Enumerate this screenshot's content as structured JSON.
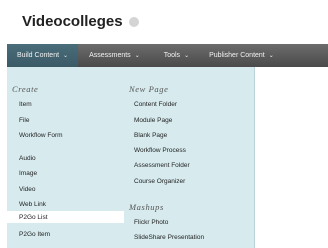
{
  "course": {
    "title": "Videocolleges"
  },
  "toolbar": {
    "build_content": "Build Content",
    "assessments": "Assessments",
    "tools": "Tools",
    "publisher_content": "Publisher Content",
    "chevron": "⌄"
  },
  "menu": {
    "create_heading": "Create",
    "create_items": [
      "Item",
      "File",
      "Workflow Form",
      "Audio",
      "Image",
      "Video",
      "Web Link",
      "P2Go List",
      "P2Go Item"
    ],
    "new_page_heading": "New Page",
    "new_page_items": [
      "Content Folder",
      "Module Page",
      "Blank Page",
      "Workflow Process",
      "Assessment Folder",
      "Course Organizer"
    ],
    "mashups_heading": "Mashups",
    "mashups_items": [
      "Flickr Photo",
      "SlideShare Presentation"
    ],
    "hovered_item": "P2Go List"
  }
}
